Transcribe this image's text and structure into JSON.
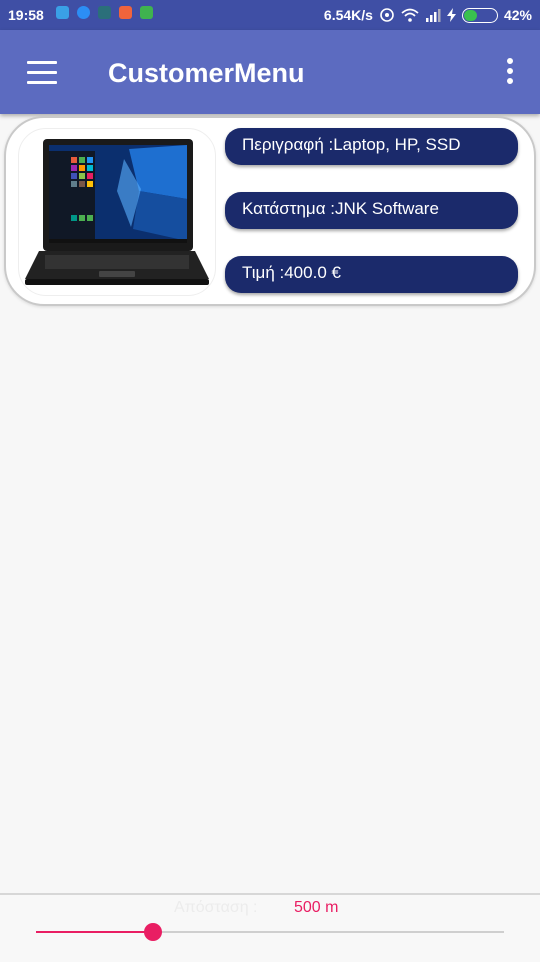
{
  "status_bar": {
    "time": "19:58",
    "speed": "6.54K/s",
    "battery_percent": "42%",
    "battery_level": 0.42
  },
  "toolbar": {
    "menu_icon": "hamburger-menu-icon",
    "title": "CustomerMenu",
    "overflow_icon": "more-vertical-icon"
  },
  "product": {
    "image": "laptop-image",
    "description": "Περιγραφή :Laptop, HP, SSD",
    "store": "Κατάστημα :JNK Software",
    "price": "Τιμή :400.0 €"
  },
  "distance": {
    "label": "Απόσταση :",
    "value": "500 m",
    "slider_fraction": 0.25
  },
  "colors": {
    "status_bar": "#3f4fa5",
    "toolbar": "#5c6bc0",
    "pill": "#1b2a6b",
    "accent": "#e91e63"
  }
}
